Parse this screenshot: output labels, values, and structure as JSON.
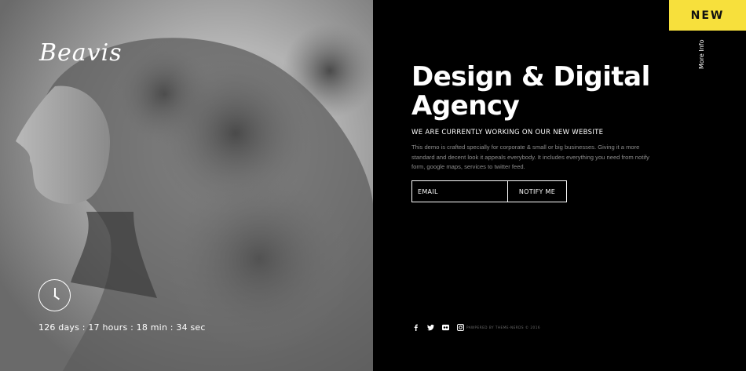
{
  "brand": {
    "logo_text": "Beavis"
  },
  "badge": {
    "label": "NEW",
    "color": "#f7e03c"
  },
  "sidebar": {
    "more_info": "More Info"
  },
  "hero": {
    "title": "Design & Digital Agency",
    "subtitle": "WE ARE CURRENTLY WORKING ON OUR NEW WEBSITE",
    "description": "This demo is crafted specially for corporate & small or big businesses. Giving it a more standard and decent look it appeals everybody. It includes everything you need from notify form, google maps, services to twitter feed."
  },
  "form": {
    "email_placeholder": "EMAIL",
    "notify_label": "NOTIFY ME"
  },
  "countdown": {
    "text": "126 days : 17 hours : 18 min : 34 sec"
  },
  "social": {
    "icons": [
      "facebook-icon",
      "twitter-icon",
      "flickr-icon",
      "instagram-icon"
    ]
  },
  "footer": {
    "powered": "PAWPERED BY THEME-NERDS © 2016"
  }
}
